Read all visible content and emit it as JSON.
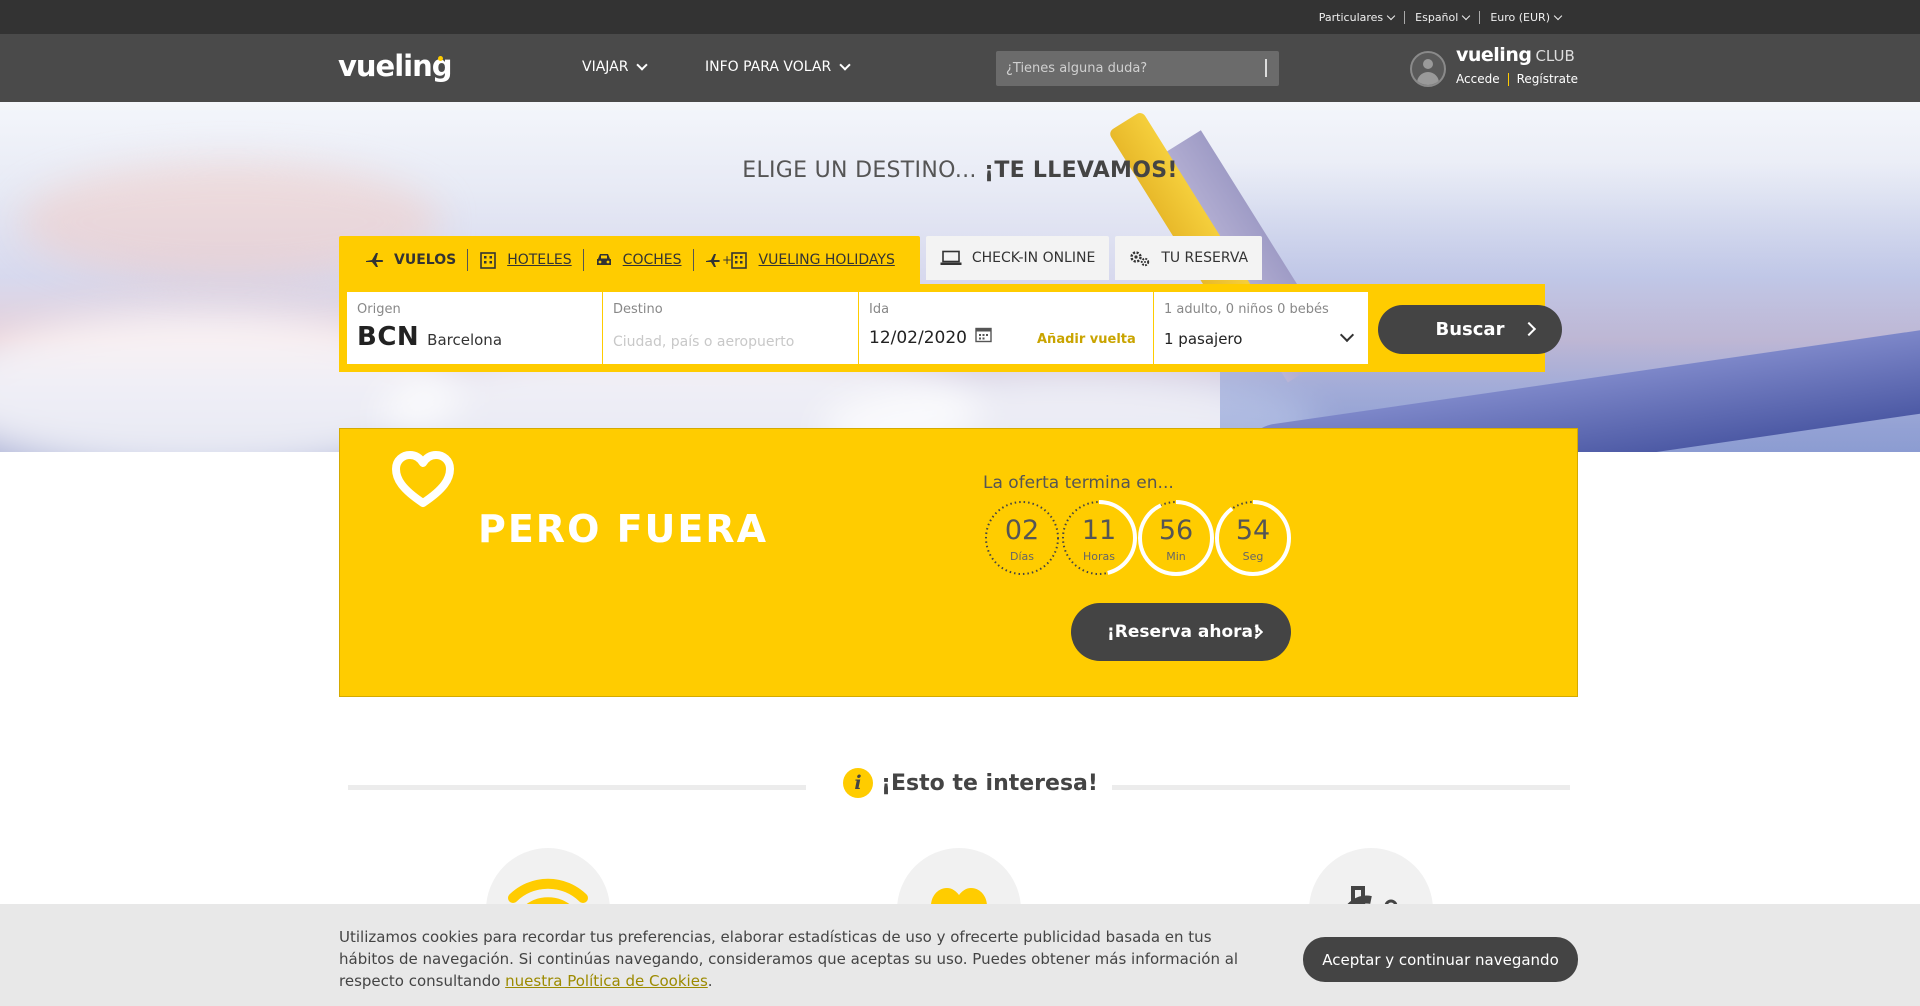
{
  "utility": {
    "items": [
      "Particulares",
      "Español",
      "Euro (EUR)"
    ]
  },
  "nav": {
    "logo": "vueling",
    "links": [
      {
        "label": "VIAJAR",
        "icon": "chevron-down-icon"
      },
      {
        "label": "INFO PARA VOLAR",
        "icon": "chevron-down-icon"
      }
    ],
    "search_placeholder": "¿Tienes alguna duda?",
    "club": {
      "brand": "vueling",
      "suffix": "CLUB",
      "login": "Accede",
      "register": "Regístrate"
    }
  },
  "hero": {
    "title_plain": "ELIGE UN DESTINO... ",
    "title_bold": "¡TE LLEVAMOS!"
  },
  "search_widget": {
    "tabs": [
      {
        "label": "VUELOS",
        "icon": "plane-icon",
        "active": true
      },
      {
        "label": "HOTELES",
        "icon": "hotel-icon",
        "active": false
      },
      {
        "label": "COCHES",
        "icon": "car-icon",
        "active": false
      },
      {
        "label": "VUELING HOLIDAYS",
        "icon": "plane-plus-hotel-icon",
        "active": false
      }
    ],
    "side_tabs": [
      {
        "label": "CHECK-IN ONLINE",
        "icon": "laptop-icon"
      },
      {
        "label": "TU RESERVA",
        "icon": "gears-icon"
      }
    ],
    "origin": {
      "label": "Origen",
      "code": "BCN",
      "city": "Barcelona"
    },
    "destination": {
      "label": "Destino",
      "placeholder": "Ciudad, país o aeropuerto"
    },
    "departure": {
      "label": "Ida",
      "value": "12/02/2020",
      "add_return": "Añadir vuelta"
    },
    "passengers": {
      "label": "1 adulto, 0 niños 0 bebés",
      "value": "1 pasajero"
    },
    "submit": "Buscar"
  },
  "promo": {
    "title": "PERO FUERA",
    "countdown_label": "La oferta termina en...",
    "countdown": [
      {
        "value": "02",
        "unit": "Días",
        "progress": 0.0
      },
      {
        "value": "11",
        "unit": "Horas",
        "progress": 0.46
      },
      {
        "value": "56",
        "unit": "Min",
        "progress": 0.93
      },
      {
        "value": "54",
        "unit": "Seg",
        "progress": 0.9
      }
    ],
    "cta": "¡Reserva ahora!"
  },
  "interesa": {
    "icon_letter": "i",
    "title": "¡Esto te interesa!",
    "features": [
      "wifi-icon",
      "heart-icon",
      "luggage-icon"
    ]
  },
  "cookies": {
    "text": "Utilizamos cookies para recordar tus preferencias, elaborar estadísticas de uso y ofrecerte publicidad basada en tus hábitos de navegación. Si continúas navegando, consideramos que aceptas su uso. Puedes obtener más información al respecto consultando ",
    "link": "nuestra Política de Cookies",
    "after": ".",
    "accept": "Aceptar y continuar navegando"
  },
  "colors": {
    "brand_yellow": "#ffcc00",
    "dark": "#444444",
    "topbar": "#333333",
    "nav": "#4a4a4a"
  }
}
